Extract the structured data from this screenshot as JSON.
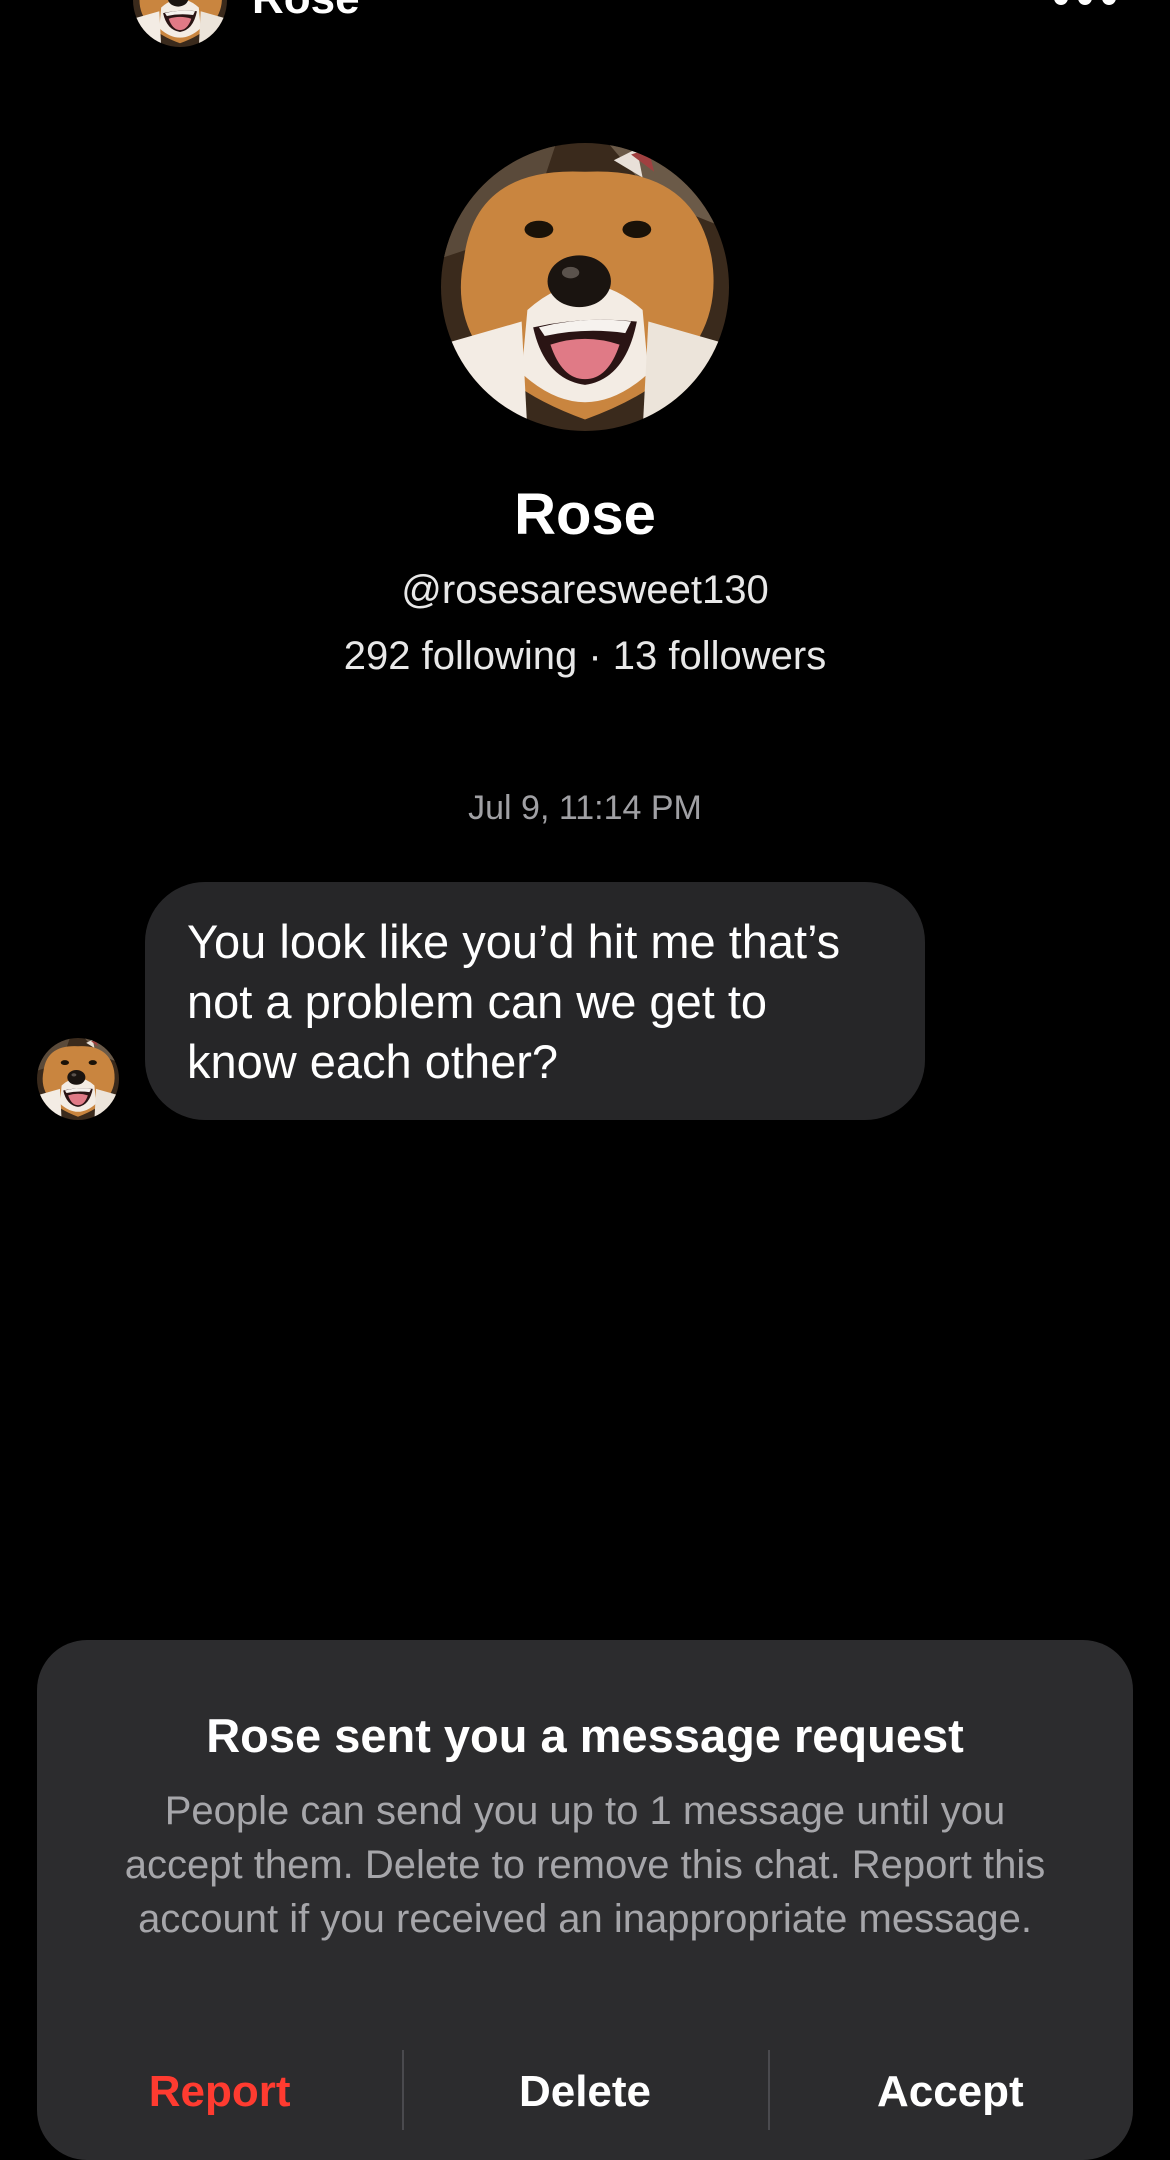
{
  "header": {
    "name": "Rose",
    "back_icon": "chevron-left-icon",
    "more_icon": "ellipsis-icon"
  },
  "profile": {
    "name": "Rose",
    "handle": "@rosesaresweet130",
    "stats": "292 following · 13 followers"
  },
  "conversation": {
    "timestamp": "Jul 9, 11:14 PM",
    "message": "You look like you’d hit me that’s not a problem can we get to know each other?"
  },
  "request_sheet": {
    "title": "Rose sent you a message request",
    "body": "People can send you up to 1 message until you accept them. Delete to remove this chat. Report this account if you received an inappropriate message.",
    "actions": {
      "report": "Report",
      "delete": "Delete",
      "accept": "Accept"
    }
  },
  "colors": {
    "background": "#000000",
    "bubble": "#262628",
    "sheet": "#2c2c2e",
    "report": "#ff3b30",
    "secondary_text": "#a6a6aa"
  }
}
